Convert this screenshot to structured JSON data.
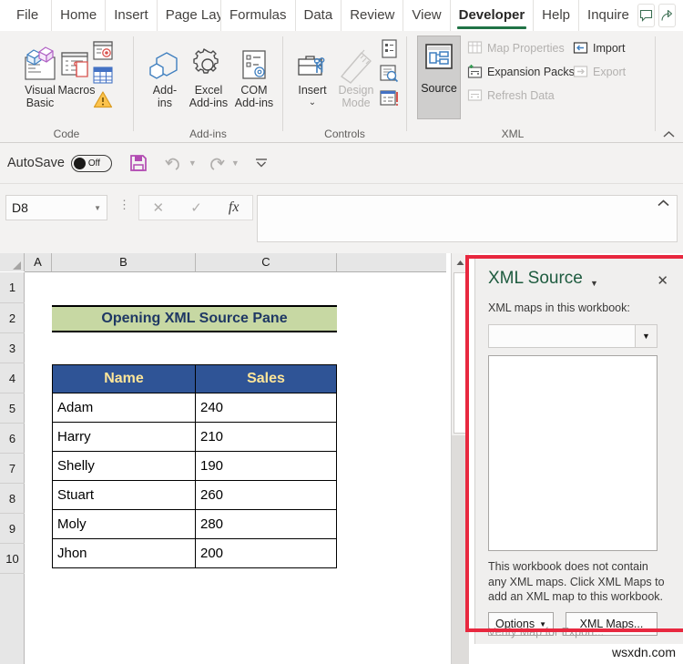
{
  "ribbon": {
    "tabs": [
      {
        "label": "File",
        "active": false
      },
      {
        "label": "Home",
        "active": false
      },
      {
        "label": "Insert",
        "active": false
      },
      {
        "label": "Page Layout",
        "active": false
      },
      {
        "label": "Formulas",
        "active": false
      },
      {
        "label": "Data",
        "active": false
      },
      {
        "label": "Review",
        "active": false
      },
      {
        "label": "View",
        "active": false
      },
      {
        "label": "Developer",
        "active": true
      },
      {
        "label": "Help",
        "active": false
      },
      {
        "label": "Inquire",
        "active": false
      }
    ],
    "right_icons": [
      {
        "name": "comments-icon",
        "glyph": "comment"
      },
      {
        "name": "share-icon",
        "glyph": "share"
      }
    ],
    "groups": [
      {
        "name": "code",
        "label": "Code"
      },
      {
        "name": "addins",
        "label": "Add-ins"
      },
      {
        "name": "controls",
        "label": "Controls"
      },
      {
        "name": "xml",
        "label": "XML"
      }
    ],
    "code": {
      "visual_basic": "Visual\nBasic",
      "visual_basic_l1": "Visual",
      "visual_basic_l2": "Basic",
      "macros": "Macros"
    },
    "addins": {
      "addins_l1": "Add-",
      "addins_l2": "ins",
      "excel_l1": "Excel",
      "excel_l2": "Add-ins",
      "com_l1": "COM",
      "com_l2": "Add-ins"
    },
    "controls": {
      "insert": "Insert",
      "design_mode_l1": "Design",
      "design_mode_l2": "Mode"
    },
    "xml": {
      "source": "Source",
      "map_properties": "Map Properties",
      "expansion_packs": "Expansion Packs",
      "refresh_data": "Refresh Data",
      "import": "Import",
      "export": "Export"
    },
    "collapse_label": "Collapse Ribbon"
  },
  "qat": {
    "autosave_label": "AutoSave",
    "autosave_state": "Off",
    "buttons": [
      {
        "name": "save-button",
        "glyph": "save"
      },
      {
        "name": "undo-button",
        "glyph": "undo"
      },
      {
        "name": "redo-button",
        "glyph": "redo"
      },
      {
        "name": "customize-qat-button",
        "glyph": "chevron-down-bar"
      }
    ]
  },
  "formula_bar": {
    "name_box_value": "D8",
    "cancel_label": "✕",
    "enter_label": "✓",
    "fx_label": "fx",
    "formula_value": ""
  },
  "sheet": {
    "columns": [
      "A",
      "B",
      "C"
    ],
    "rows": [
      "1",
      "2",
      "3",
      "4",
      "5",
      "6",
      "7",
      "8",
      "9",
      "10"
    ],
    "title_cell": "Opening XML Source Pane",
    "table_headers": [
      "Name",
      "Sales"
    ],
    "table_rows": [
      [
        "Adam",
        "240"
      ],
      [
        "Harry",
        "210"
      ],
      [
        "Shelly",
        "190"
      ],
      [
        "Stuart",
        "260"
      ],
      [
        "Moly",
        "280"
      ],
      [
        "Jhon",
        "200"
      ]
    ]
  },
  "xml_pane": {
    "title": "XML Source",
    "close_label": "✕",
    "subtitle": "XML maps in this workbook:",
    "combo_value": "",
    "message": "This workbook does not contain any XML maps. Click XML Maps to add an XML map to this workbook.",
    "options_button": "Options",
    "xml_maps_button": "XML Maps...",
    "verify_link": "Verify Map for Export..."
  },
  "watermark": "wsxdn.com",
  "colors": {
    "accent_green": "#217346",
    "pane_title_green": "#1e5b3f",
    "title_cell_bg": "#c7d8a3",
    "title_cell_fg": "#1f3864",
    "header_cell_bg": "#2f5496",
    "header_cell_fg": "#ffe699",
    "highlight_red": "#e8283f",
    "ribbon_bg": "#f3f2f1"
  }
}
